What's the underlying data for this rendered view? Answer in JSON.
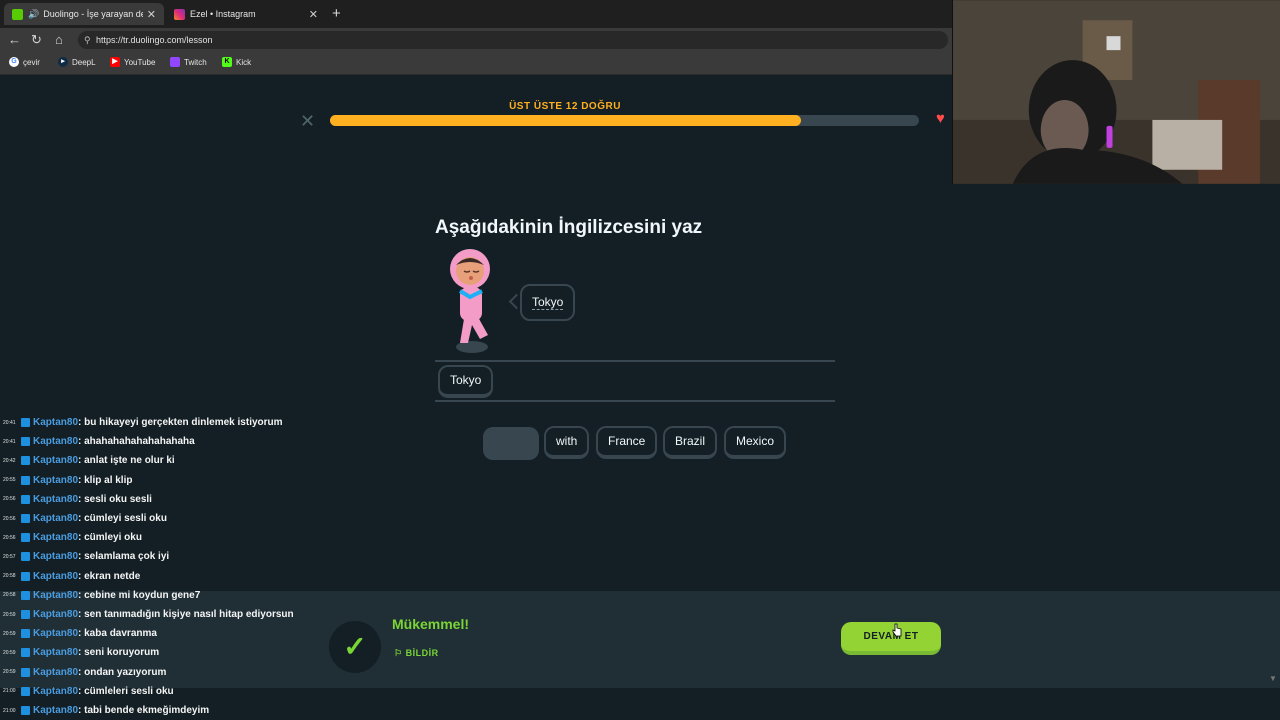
{
  "browser": {
    "tabs": [
      {
        "title": "Duolingo - İşe yarayan dersler",
        "close": "✕"
      },
      {
        "title": "Ezel • Instagram",
        "close": "✕"
      }
    ],
    "new_tab": "+",
    "url": "https://tr.duolingo.com/lesson",
    "bookmarks": [
      "çevir",
      "DeepL",
      "YouTube",
      "Twitch",
      "Kick"
    ]
  },
  "lesson": {
    "streak_label": "ÜST ÜSTE 12 DOĞRU",
    "progress": 0.8,
    "prompt": "Aşağıdakinin İngilizcesini yaz",
    "bubble_word": "Tokyo",
    "selected_words": [
      "Tokyo"
    ],
    "word_bank": [
      "with",
      "France",
      "Brazil",
      "Mexico"
    ]
  },
  "feedback": {
    "title": "Mükemmel!",
    "report": "BİLDİR",
    "continue": "DEVAM ET"
  },
  "chat": [
    {
      "time": "20:41",
      "user": "Kaptan80",
      "msg": ": bu hikayeyi gerçekten dinlemek istiyorum"
    },
    {
      "time": "20:41",
      "user": "Kaptan80",
      "msg": ": ahahahahahahahahaha"
    },
    {
      "time": "20:42",
      "user": "Kaptan80",
      "msg": ": anlat işte ne olur ki"
    },
    {
      "time": "20:55",
      "user": "Kaptan80",
      "msg": ": klip al klip"
    },
    {
      "time": "20:56",
      "user": "Kaptan80",
      "msg": ": sesli oku sesli"
    },
    {
      "time": "20:56",
      "user": "Kaptan80",
      "msg": ": cümleyi sesli oku"
    },
    {
      "time": "20:56",
      "user": "Kaptan80",
      "msg": ": cümleyi oku"
    },
    {
      "time": "20:57",
      "user": "Kaptan80",
      "msg": ": selamlama çok iyi"
    },
    {
      "time": "20:58",
      "user": "Kaptan80",
      "msg": ": ekran netde"
    },
    {
      "time": "20:58",
      "user": "Kaptan80",
      "msg": ": cebine mi koydun gene7"
    },
    {
      "time": "20:59",
      "user": "Kaptan80",
      "msg": ": sen tanımadığın kişiye nasıl hitap ediyorsun"
    },
    {
      "time": "20:59",
      "user": "Kaptan80",
      "msg": ": kaba davranma"
    },
    {
      "time": "20:59",
      "user": "Kaptan80",
      "msg": ": seni koruyorum"
    },
    {
      "time": "20:59",
      "user": "Kaptan80",
      "msg": ": ondan yazıyorum"
    },
    {
      "time": "21:00",
      "user": "Kaptan80",
      "msg": ": cümleleri sesli oku"
    },
    {
      "time": "21:00",
      "user": "Kaptan80",
      "msg": ": tabi bende ekmeğimdeyim"
    }
  ],
  "colors": {
    "accent_green": "#93d333",
    "progress_orange": "#ffb020",
    "background": "#131f24"
  }
}
